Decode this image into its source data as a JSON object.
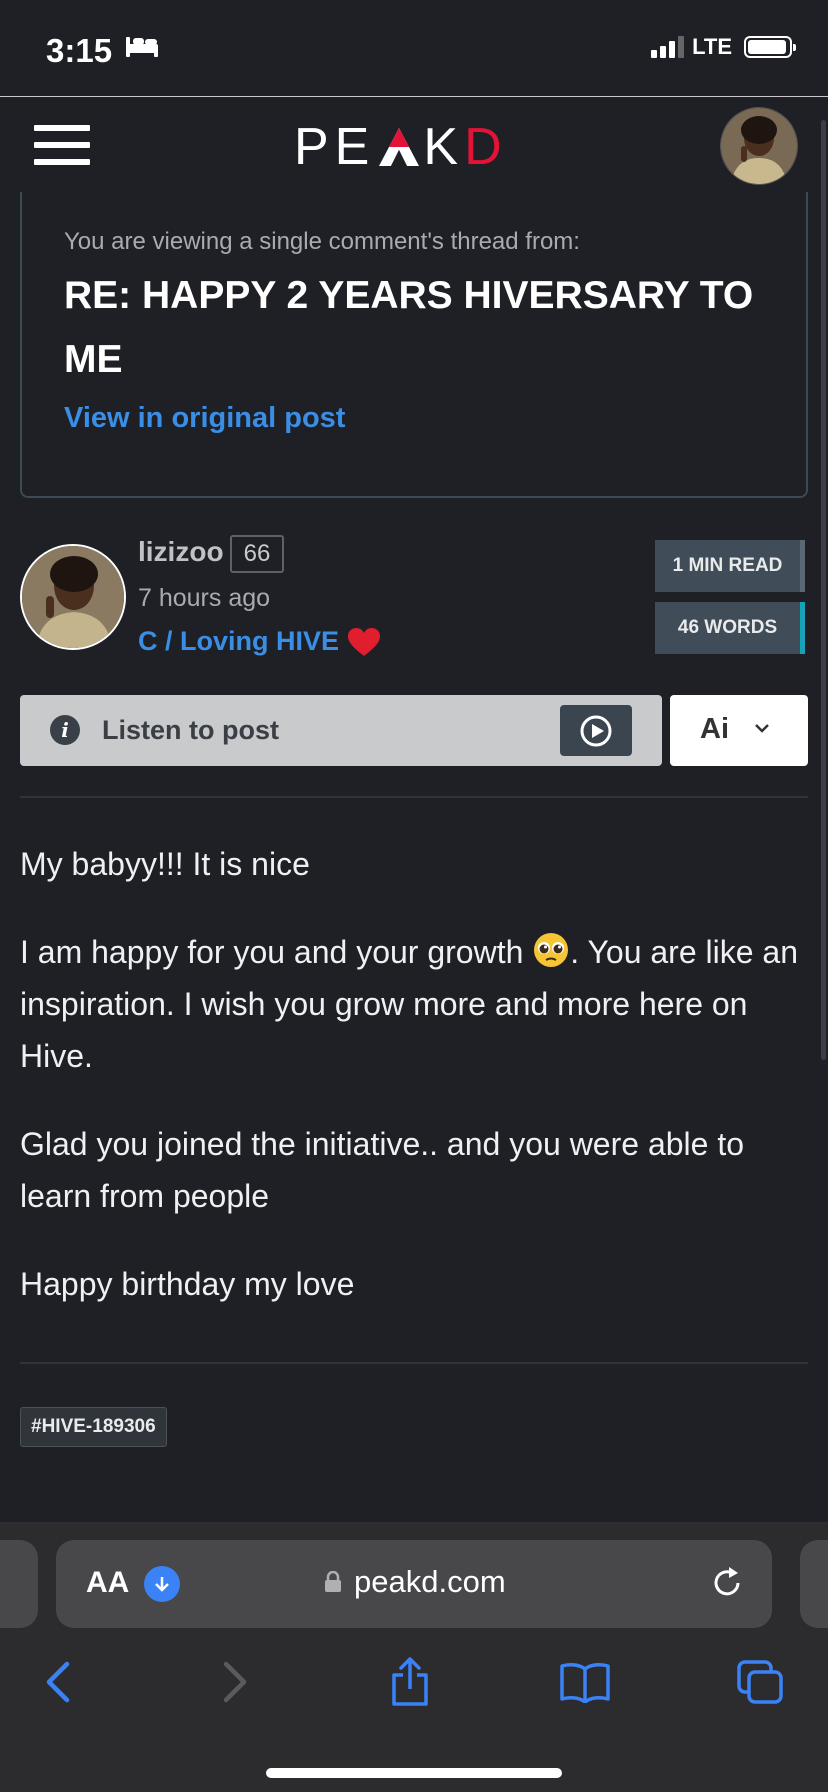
{
  "status_bar": {
    "time": "3:15",
    "network": "LTE",
    "battery_percent": 90,
    "signal_bars": 3
  },
  "nav": {
    "logo_prefix": "PE",
    "logo_mid": "K",
    "logo_suffix": "D"
  },
  "thread": {
    "lead": "You are viewing a single comment's thread from:",
    "title": "RE: HAPPY 2 YEARS HIVERSARY TO ME",
    "link": "View in original post"
  },
  "author": {
    "name": "lizizoo",
    "reputation": "66",
    "time": "7 hours ago",
    "community": "C / Loving HIVE"
  },
  "badges": {
    "read_time": "1 MIN READ",
    "words": "46 WORDS"
  },
  "listen": {
    "label": "Listen to post",
    "voice": "Ai"
  },
  "content": {
    "p1": "My babyy!!! It is nice",
    "p2a": "I am happy for you and your growth ",
    "p2b": ". You are like an inspiration. I wish you grow more and more here on Hive.",
    "p3": "Glad you joined the initiative.. and you were able to learn from people",
    "p4": "Happy birthday my love"
  },
  "tags": [
    "HIVE-189306"
  ],
  "tag_prefix": "#",
  "browser": {
    "text_size": "AA",
    "url": "peakd.com"
  },
  "colors": {
    "accent_blue": "#3a8ee6",
    "brand_red": "#e31337",
    "background": "#1e2025"
  }
}
